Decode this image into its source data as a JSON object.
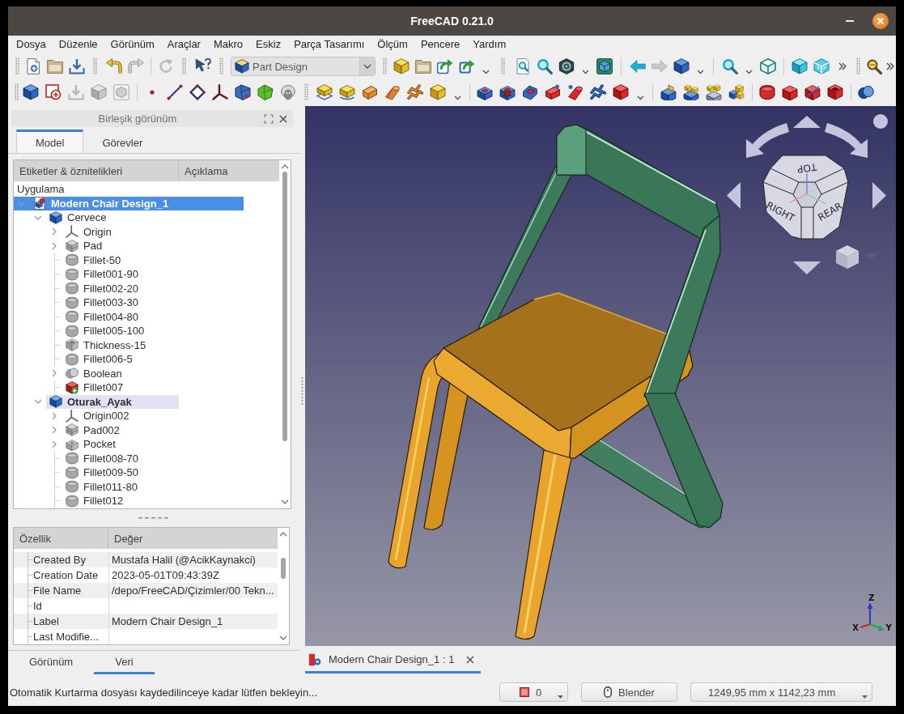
{
  "window": {
    "title": "FreeCAD 0.21.0"
  },
  "menu": [
    "Dosya",
    "Düzenle",
    "Görünüm",
    "Araçlar",
    "Makro",
    "Eskiz",
    "Parça Tasarımı",
    "Ölçüm",
    "Pencere",
    "Yardım"
  ],
  "toolbar": {
    "workbench": "Part Design"
  },
  "combo_view": {
    "title": "Birleşik görünüm",
    "tabs": [
      {
        "label": "Model",
        "selected": true
      },
      {
        "label": "Görevler",
        "selected": false
      }
    ]
  },
  "tree": {
    "columns": [
      "Etiketler & öznitelikleri",
      "Açıklama"
    ],
    "root_label": "Uygulama",
    "items": [
      {
        "label": "Modern Chair Design_1",
        "kind": "document",
        "selected": true,
        "active": true,
        "expanded": true,
        "children": [
          {
            "label": "Cervece",
            "kind": "body",
            "selected": false,
            "active": false,
            "expanded": true,
            "children": [
              {
                "label": "Origin",
                "kind": "origin",
                "selected": false,
                "active": false,
                "expanded": false
              },
              {
                "label": "Pad",
                "kind": "pad",
                "selected": false,
                "active": false,
                "expanded": false
              },
              {
                "label": "Fillet-50",
                "kind": "fillet",
                "selected": false,
                "active": false
              },
              {
                "label": "Fillet001-90",
                "kind": "fillet",
                "selected": false,
                "active": false
              },
              {
                "label": "Fillet002-20",
                "kind": "fillet",
                "selected": false,
                "active": false
              },
              {
                "label": "Fillet003-30",
                "kind": "fillet",
                "selected": false,
                "active": false
              },
              {
                "label": "Fillet004-80",
                "kind": "fillet",
                "selected": false,
                "active": false
              },
              {
                "label": "Fillet005-100",
                "kind": "fillet",
                "selected": false,
                "active": false
              },
              {
                "label": "Thickness-15",
                "kind": "thickness",
                "selected": false,
                "active": false
              },
              {
                "label": "Fillet006-5",
                "kind": "fillet",
                "selected": false,
                "active": false
              },
              {
                "label": "Boolean",
                "kind": "boolean",
                "selected": false,
                "active": false,
                "expanded": false
              },
              {
                "label": "Fillet007",
                "kind": "tip",
                "selected": false,
                "active": false
              }
            ]
          },
          {
            "label": "Oturak_Ayak",
            "kind": "body",
            "selected": false,
            "active": true,
            "expanded": true,
            "children": [
              {
                "label": "Origin002",
                "kind": "origin",
                "selected": false,
                "active": false,
                "expanded": false
              },
              {
                "label": "Pad002",
                "kind": "pad",
                "selected": false,
                "active": false,
                "expanded": false
              },
              {
                "label": "Pocket",
                "kind": "pocket",
                "selected": false,
                "active": false,
                "expanded": false
              },
              {
                "label": "Fillet008-70",
                "kind": "fillet",
                "selected": false,
                "active": false
              },
              {
                "label": "Fillet009-50",
                "kind": "fillet",
                "selected": false,
                "active": false
              },
              {
                "label": "Fillet011-80",
                "kind": "fillet",
                "selected": false,
                "active": false
              },
              {
                "label": "Fillet012",
                "kind": "fillet",
                "selected": false,
                "active": false
              }
            ]
          }
        ]
      }
    ]
  },
  "properties": {
    "columns": [
      "Özellik",
      "Değer"
    ],
    "rows": [
      {
        "name": "Created By",
        "value": "Mustafa Halil (@AcikKaynakci)"
      },
      {
        "name": "Creation Date",
        "value": "2023-05-01T09:43:39Z"
      },
      {
        "name": "File Name",
        "value": "/depo/FreeCAD/Çizimler/00 Tekn..."
      },
      {
        "name": "Id"
      },
      {
        "name": "Label",
        "value": "Modern Chair Design_1"
      },
      {
        "name": "Last Modifie..."
      }
    ]
  },
  "property_tabs": [
    {
      "label": "Görünüm",
      "selected": false
    },
    {
      "label": "Veri",
      "selected": true
    }
  ],
  "viewport": {
    "face_labels": [
      "TOP",
      "RIGHT",
      "REAR"
    ],
    "axis_labels": [
      "X",
      "Y",
      "Z"
    ]
  },
  "document_tabs": [
    {
      "label": "Modern Chair Design_1 : 1",
      "selected": true
    }
  ],
  "status_bar": {
    "message": "Otomatik Kurtarma dosyası kaydedilinceye kadar lütfen bekleyin...",
    "selection_count": "0",
    "navigation_style": "Blender",
    "dimensions": "1249,95 mm x 1142,23 mm"
  }
}
